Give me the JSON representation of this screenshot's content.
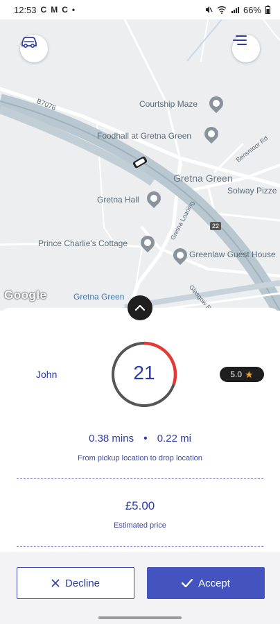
{
  "status_bar": {
    "time": "12:53",
    "left_icons": [
      "C",
      "M",
      "C",
      "•"
    ],
    "battery": "66%"
  },
  "map": {
    "labels": {
      "road_b7076": "B7076",
      "courtship_maze": "Courtship Maze",
      "foodhall": "Foodhall at Gretna Green",
      "gretna_green_town": "Gretna Green",
      "solway_pizza": "Solway Pizze",
      "gretna_hall": "Gretna Hall",
      "prince_charlies": "Prince Charlie's Cottage",
      "greenlaw": "Greenlaw Guest House",
      "gretna_loaning": "Gretna Loaning",
      "bensmoor_rd": "Bensmoor Rd",
      "road_shield": "22",
      "gretna_green_station": "Gretna Green",
      "glasgow_road": "Glasgow Rd"
    },
    "google_logo": "Google"
  },
  "offer": {
    "driver_name": "John",
    "countdown": "21",
    "countdown_fraction": 0.3,
    "rating": "5.0",
    "duration": "0.38 mins",
    "separator": "•",
    "distance": "0.22 mi",
    "trip_caption": "From pickup location to drop location",
    "price": "£5.00",
    "price_caption": "Estimated price"
  },
  "actions": {
    "decline_label": "Decline",
    "accept_label": "Accept"
  },
  "colors": {
    "primary": "#4354c0",
    "text_blue": "#2c3aa8",
    "timer_red": "#e53935",
    "timer_grey": "#555555"
  }
}
